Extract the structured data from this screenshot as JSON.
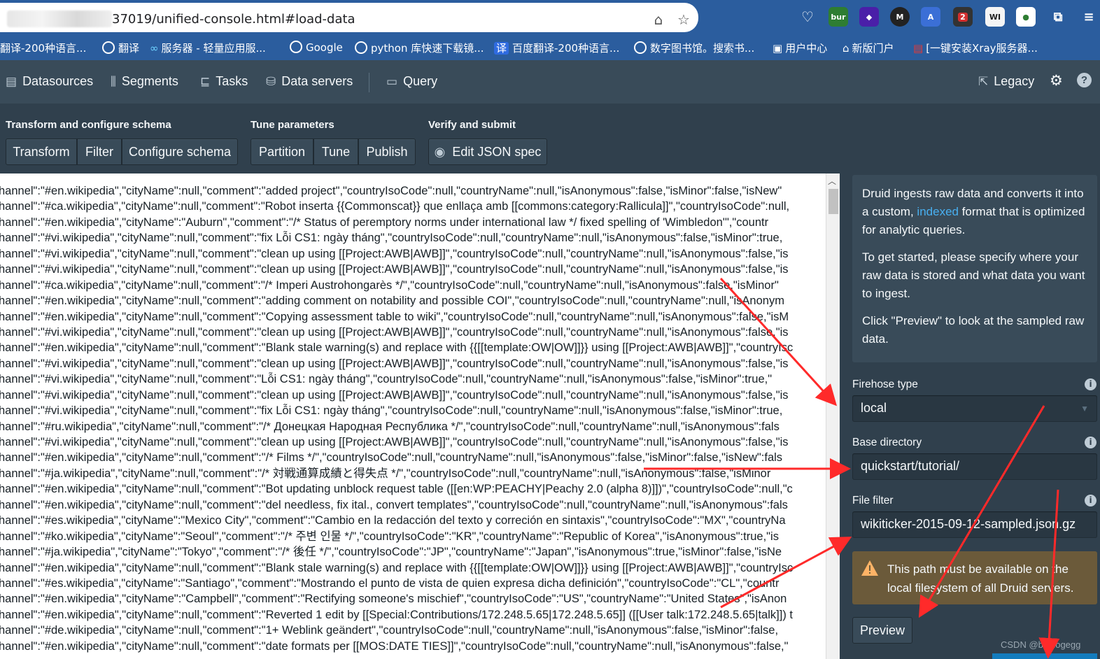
{
  "browser": {
    "url": "37019/unified-console.html#load-data",
    "bookmarks": [
      "翻译-200种语言...",
      "翻译",
      "服务器 - 轻量应用服...",
      "Google",
      "python 库快速下载镜...",
      "百度翻译-200种语言...",
      "数字图书馆。搜索书...",
      "用户中心",
      "新版门户",
      "[一键安装Xray服务器..."
    ],
    "extensions": [
      "bur",
      "2",
      "WI"
    ]
  },
  "nav": {
    "items": [
      "Datasources",
      "Segments",
      "Tasks",
      "Data servers",
      "Query"
    ],
    "legacy": "Legacy"
  },
  "steps": {
    "groups": [
      {
        "title": "Transform and configure schema",
        "buttons": [
          "Transform",
          "Filter",
          "Configure schema"
        ]
      },
      {
        "title": "Tune parameters",
        "buttons": [
          "Partition",
          "Tune",
          "Publish"
        ]
      },
      {
        "title": "Verify and submit",
        "buttons": [
          "Edit JSON spec"
        ]
      }
    ]
  },
  "data_lines": [
    "hannel\":\"#en.wikipedia\",\"cityName\":null,\"comment\":\"added project\",\"countryIsoCode\":null,\"countryName\":null,\"isAnonymous\":false,\"isMinor\":false,\"isNew\"",
    "hannel\":\"#ca.wikipedia\",\"cityName\":null,\"comment\":\"Robot inserta {{Commonscat}} que enllaça amb [[commons:category:Rallicula]]\",\"countryIsoCode\":null,",
    "hannel\":\"#en.wikipedia\",\"cityName\":\"Auburn\",\"comment\":\"/* Status of peremptory norms under international law */ fixed spelling of 'Wimbledon'\",\"countr",
    "hannel\":\"#vi.wikipedia\",\"cityName\":null,\"comment\":\"fix Lỗi CS1: ngày tháng\",\"countryIsoCode\":null,\"countryName\":null,\"isAnonymous\":false,\"isMinor\":true,",
    "hannel\":\"#vi.wikipedia\",\"cityName\":null,\"comment\":\"clean up using [[Project:AWB|AWB]]\",\"countryIsoCode\":null,\"countryName\":null,\"isAnonymous\":false,\"is",
    "hannel\":\"#vi.wikipedia\",\"cityName\":null,\"comment\":\"clean up using [[Project:AWB|AWB]]\",\"countryIsoCode\":null,\"countryName\":null,\"isAnonymous\":false,\"is",
    "hannel\":\"#ca.wikipedia\",\"cityName\":null,\"comment\":\"/* Imperi Austrohongarès */\",\"countryIsoCode\":null,\"countryName\":null,\"isAnonymous\":false,\"isMinor\"",
    "hannel\":\"#en.wikipedia\",\"cityName\":null,\"comment\":\"adding comment on notability and possible COI\",\"countryIsoCode\":null,\"countryName\":null,\"isAnonym",
    "hannel\":\"#en.wikipedia\",\"cityName\":null,\"comment\":\"Copying assessment table to wiki\",\"countryIsoCode\":null,\"countryName\":null,\"isAnonymous\":false,\"isM",
    "hannel\":\"#vi.wikipedia\",\"cityName\":null,\"comment\":\"clean up using [[Project:AWB|AWB]]\",\"countryIsoCode\":null,\"countryName\":null,\"isAnonymous\":false,\"is",
    "hannel\":\"#en.wikipedia\",\"cityName\":null,\"comment\":\"Blank stale warning(s) and replace with {{[[template:OW|OW]]}} using [[Project:AWB|AWB]]\",\"countryIsc",
    "hannel\":\"#vi.wikipedia\",\"cityName\":null,\"comment\":\"clean up using [[Project:AWB|AWB]]\",\"countryIsoCode\":null,\"countryName\":null,\"isAnonymous\":false,\"is",
    "hannel\":\"#vi.wikipedia\",\"cityName\":null,\"comment\":\"Lỗi CS1: ngày tháng\",\"countryIsoCode\":null,\"countryName\":null,\"isAnonymous\":false,\"isMinor\":true,\"",
    "hannel\":\"#vi.wikipedia\",\"cityName\":null,\"comment\":\"clean up using [[Project:AWB|AWB]]\",\"countryIsoCode\":null,\"countryName\":null,\"isAnonymous\":false,\"is",
    "hannel\":\"#vi.wikipedia\",\"cityName\":null,\"comment\":\"fix Lỗi CS1: ngày tháng\",\"countryIsoCode\":null,\"countryName\":null,\"isAnonymous\":false,\"isMinor\":true,",
    "hannel\":\"#ru.wikipedia\",\"cityName\":null,\"comment\":\"/* Донецкая Народная Республика */\",\"countryIsoCode\":null,\"countryName\":null,\"isAnonymous\":fals",
    "hannel\":\"#vi.wikipedia\",\"cityName\":null,\"comment\":\"clean up using [[Project:AWB|AWB]]\",\"countryIsoCode\":null,\"countryName\":null,\"isAnonymous\":false,\"is",
    "hannel\":\"#en.wikipedia\",\"cityName\":null,\"comment\":\"/* Films */\",\"countryIsoCode\":null,\"countryName\":null,\"isAnonymous\":false,\"isMinor\":false,\"isNew\":fals",
    "hannel\":\"#ja.wikipedia\",\"cityName\":null,\"comment\":\"/* 対戦通算成績と得失点 */\",\"countryIsoCode\":null,\"countryName\":null,\"isAnonymous\":false,\"isMinor",
    "hannel\":\"#en.wikipedia\",\"cityName\":null,\"comment\":\"Bot updating unblock request table ([[en:WP:PEACHY|Peachy 2.0 (alpha 8)]])\",\"countryIsoCode\":null,\"c",
    "hannel\":\"#en.wikipedia\",\"cityName\":null,\"comment\":\"del needless, fix ital., convert templates\",\"countryIsoCode\":null,\"countryName\":null,\"isAnonymous\":fals",
    "hannel\":\"#es.wikipedia\",\"cityName\":\"Mexico City\",\"comment\":\"Cambio en la redacción del texto y correción en sintaxis\",\"countryIsoCode\":\"MX\",\"countryNa",
    "hannel\":\"#ko.wikipedia\",\"cityName\":\"Seoul\",\"comment\":\"/* 주변 인물 */\",\"countryIsoCode\":\"KR\",\"countryName\":\"Republic of Korea\",\"isAnonymous\":true,\"is",
    "hannel\":\"#ja.wikipedia\",\"cityName\":\"Tokyo\",\"comment\":\"/* 後任 */\",\"countryIsoCode\":\"JP\",\"countryName\":\"Japan\",\"isAnonymous\":true,\"isMinor\":false,\"isNe",
    "hannel\":\"#en.wikipedia\",\"cityName\":null,\"comment\":\"Blank stale warning(s) and replace with {{[[template:OW|OW]]}} using [[Project:AWB|AWB]]\",\"countryIsc",
    "hannel\":\"#es.wikipedia\",\"cityName\":\"Santiago\",\"comment\":\"Mostrando el punto de vista de quien expresa dicha definición\",\"countryIsoCode\":\"CL\",\"countr",
    "hannel\":\"#en.wikipedia\",\"cityName\":\"Campbell\",\"comment\":\"Rectifying someone's mischief\",\"countryIsoCode\":\"US\",\"countryName\":\"United States\",\"isAnon",
    "hannel\":\"#en.wikipedia\",\"cityName\":null,\"comment\":\"Reverted 1 edit by [[Special:Contributions/172.248.5.65|172.248.5.65]] ([[User talk:172.248.5.65|talk]]) t",
    "hannel\":\"#de.wikipedia\",\"cityName\":null,\"comment\":\"1+ Weblink geändert\",\"countryIsoCode\":null,\"countryName\":null,\"isAnonymous\":false,\"isMinor\":false,",
    "hannel\":\"#en.wikipedia\",\"cityName\":null,\"comment\":\"date formats per [[MOS:DATE TIES]]\",\"countryIsoCode\":null,\"countryName\":null,\"isAnonymous\":false,\""
  ],
  "side": {
    "info_p1_before": "Druid ingests raw data and converts it into a custom, ",
    "info_p1_link": "indexed",
    "info_p1_after": " format that is optimized for analytic queries.",
    "info_p2": "To get started, please specify where your raw data is stored and what data you want to ingest.",
    "info_p3": "Click \"Preview\" to look at the sampled raw data.",
    "firehose_label": "Firehose type",
    "firehose_value": "local",
    "base_dir_label": "Base directory",
    "base_dir_value": "quickstart/tutorial/",
    "file_filter_label": "File filter",
    "file_filter_value": "wikiticker-2015-09-12-sampled.json.gz",
    "callout": "This path must be available on the local filesystem of all Druid servers.",
    "preview": "Preview"
  },
  "watermark": "CSDN @biddogegg",
  "colors": {
    "annotation_arrow": "#ff2a2a",
    "link": "#48aff0",
    "warning": "#6b5a3a"
  }
}
